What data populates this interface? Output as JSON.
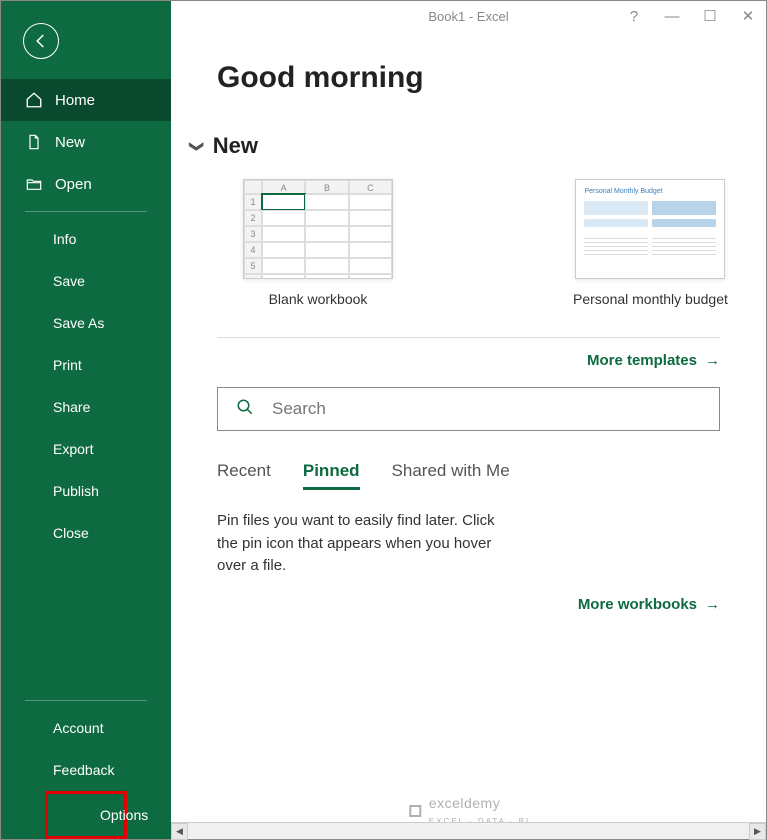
{
  "titlebar": {
    "title": "Book1 - Excel",
    "help": "?",
    "min": "—",
    "max": "☐",
    "close": "✕"
  },
  "sidebar": {
    "home": "Home",
    "new": "New",
    "open": "Open",
    "info": "Info",
    "save": "Save",
    "saveas": "Save As",
    "print": "Print",
    "share": "Share",
    "export": "Export",
    "publish": "Publish",
    "close": "Close",
    "account": "Account",
    "feedback": "Feedback",
    "options": "Options"
  },
  "main": {
    "greeting": "Good morning",
    "new_section": "New",
    "templates": {
      "blank": "Blank workbook",
      "budget": "Personal monthly budget"
    },
    "more_templates": "More templates",
    "search_placeholder": "Search",
    "tabs": {
      "recent": "Recent",
      "pinned": "Pinned",
      "shared": "Shared with Me"
    },
    "pin_message": "Pin files you want to easily find later. Click the pin icon that appears when you hover over a file.",
    "more_workbooks": "More workbooks"
  },
  "watermark": {
    "brand": "exceldemy",
    "sub": "EXCEL · DATA · BI"
  }
}
